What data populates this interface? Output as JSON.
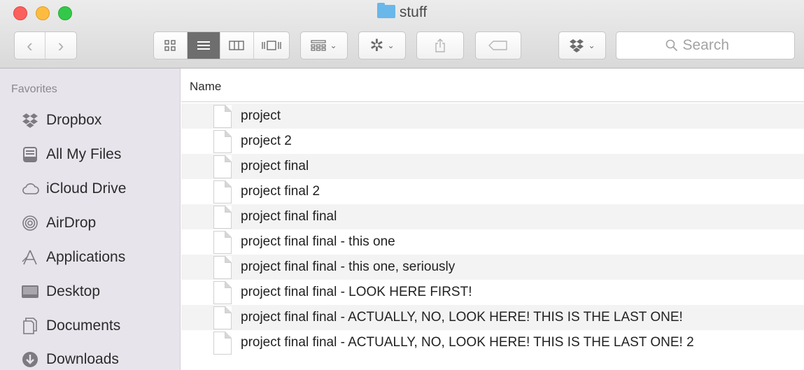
{
  "window": {
    "title": "stuff"
  },
  "toolbar": {
    "back_icon": "chevron-left-icon",
    "forward_icon": "chevron-right-icon",
    "views": [
      "icon-view-icon",
      "list-view-icon",
      "column-view-icon",
      "cover-flow-icon"
    ],
    "active_view": "list",
    "search": {
      "placeholder": "Search",
      "value": ""
    }
  },
  "sidebar": {
    "section_title": "Favorites",
    "items": [
      {
        "label": "Dropbox",
        "icon": "dropbox-icon"
      },
      {
        "label": "All My Files",
        "icon": "all-files-icon"
      },
      {
        "label": "iCloud Drive",
        "icon": "cloud-icon"
      },
      {
        "label": "AirDrop",
        "icon": "airdrop-icon"
      },
      {
        "label": "Applications",
        "icon": "applications-icon"
      },
      {
        "label": "Desktop",
        "icon": "desktop-icon"
      },
      {
        "label": "Documents",
        "icon": "documents-icon"
      },
      {
        "label": "Downloads",
        "icon": "downloads-icon"
      }
    ]
  },
  "file_list": {
    "column_header": "Name",
    "files": [
      "project",
      "project 2",
      "project final",
      "project final 2",
      "project final final",
      "project final final - this one",
      "project final final - this one, seriously",
      "project final final - LOOK HERE FIRST!",
      "project final final - ACTUALLY, NO, LOOK HERE! THIS IS THE LAST ONE!",
      "project final final - ACTUALLY, NO, LOOK HERE! THIS IS THE LAST ONE! 2"
    ]
  },
  "colors": {
    "sidebar_bg": "#e8e4ec",
    "toolbar_bg": "#dcdcdc",
    "folder_blue": "#6ab7ea",
    "close": "#fc605c",
    "minimize": "#fdbc40",
    "zoom": "#34c84a"
  }
}
